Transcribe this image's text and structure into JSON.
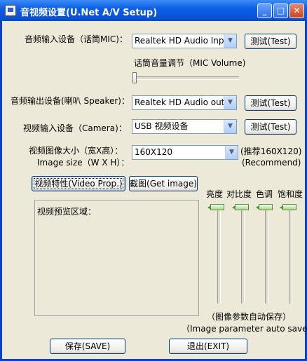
{
  "window": {
    "title": "音视频设置(U.Net A/V Setup)",
    "controls": [
      "_",
      "□",
      "✕"
    ]
  },
  "audio_input": {
    "label": "音频输入设备（话筒MIC)：",
    "value": "Realtek HD Audio Input",
    "test_label": "测试(Test)"
  },
  "mic_volume": {
    "label": "话筒音量调节（MIC Volume)",
    "level": 0
  },
  "audio_output": {
    "label": "音频输出设备(喇叭 Speaker)：",
    "value": "Realtek HD Audio output",
    "test_label": "测试(Test)"
  },
  "video_input": {
    "label": "视频输入设备（Camera)：",
    "value": "USB 视频设备",
    "test_label": "测试(Test)"
  },
  "image_size": {
    "label_cn": "视频图像大小（宽X高）：",
    "label_en": "Image size（W X H）：",
    "value": "160X120",
    "hint_cn": "(推荐160X120)",
    "hint_en": "(Recommend)"
  },
  "buttons": {
    "video_prop": "视频特性(Video Prop.)",
    "get_image": "截图(Get image)",
    "save": "保存(SAVE)",
    "exit": "退出(EXIT)"
  },
  "preview": {
    "label": "视频预览区域："
  },
  "image_sliders": [
    {
      "label": "亮度",
      "level": 1
    },
    {
      "label": "对比度",
      "level": 1
    },
    {
      "label": "色调",
      "level": 1
    },
    {
      "label": "饱和度",
      "level": 1
    }
  ],
  "auto_save_note": {
    "cn": "（图像参数自动保存）",
    "en": "（Image parameter auto save）"
  }
}
